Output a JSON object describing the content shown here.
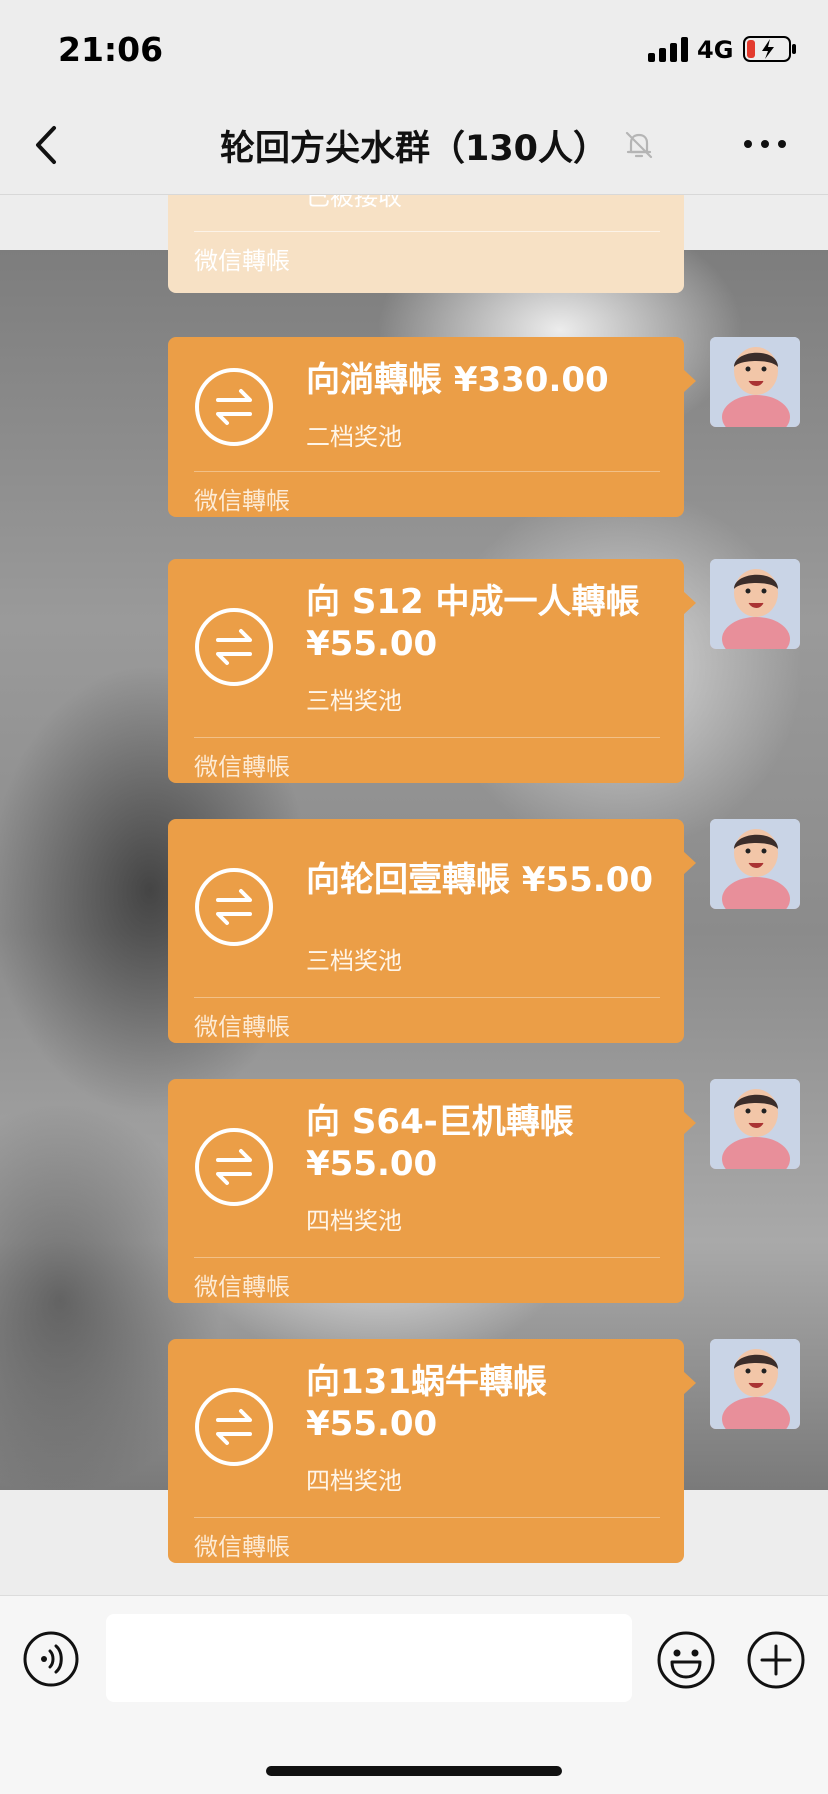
{
  "status_bar": {
    "time": "21:06",
    "network": "4G"
  },
  "nav": {
    "title": "轮回方尖水群（130人）",
    "back_icon": "chevron-left-icon",
    "mute_icon": "bell-muted-icon",
    "more_icon": "more-icon"
  },
  "received_message": {
    "status": "已被接收",
    "footer": "微信轉帳"
  },
  "messages": [
    {
      "title": "向淌轉帳 ¥330.00",
      "note": "二档奖池",
      "footer": "微信轉帳"
    },
    {
      "title": "向 S12 中成一人轉帳\n¥55.00",
      "note": "三档奖池",
      "footer": "微信轉帳"
    },
    {
      "title": "向轮回壹轉帳 ¥55.00",
      "note": "三档奖池",
      "footer": "微信轉帳"
    },
    {
      "title": "向 S64-巨机轉帳\n¥55.00",
      "note": "四档奖池",
      "footer": "微信轉帳"
    },
    {
      "title": "向131蜗牛轉帳\n¥55.00",
      "note": "四档奖池",
      "footer": "微信轉帳"
    }
  ],
  "input_bar": {
    "voice_icon": "voice-icon",
    "emoji_icon": "emoji-icon",
    "plus_icon": "plus-icon",
    "placeholder": ""
  },
  "colors": {
    "card": "#eb9e47",
    "card_received": "#f7e1c5",
    "background": "#ededed"
  }
}
